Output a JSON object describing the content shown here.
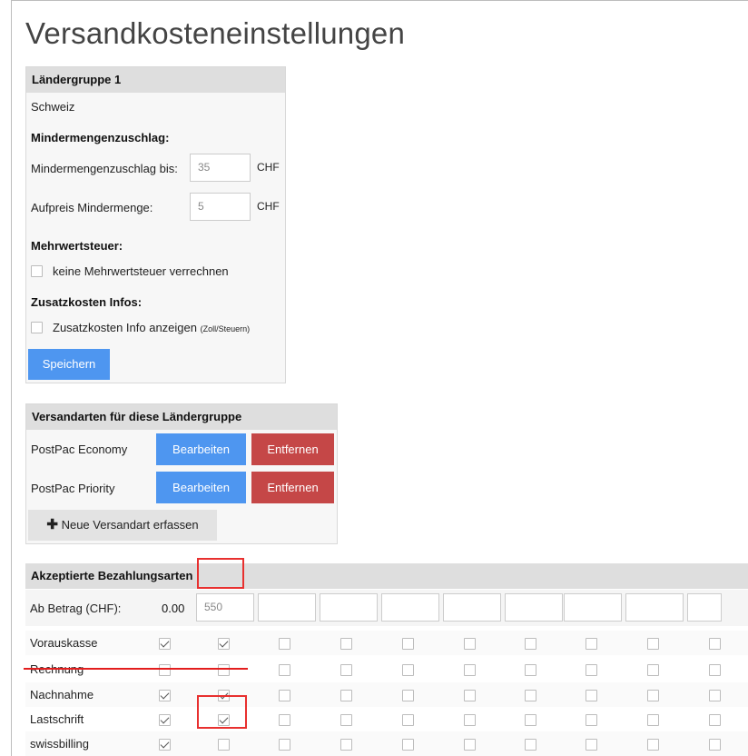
{
  "page": {
    "title": "Versandkosteneinstellungen"
  },
  "country_group": {
    "heading": "Ländergruppe 1",
    "country": "Schweiz",
    "surcharge_heading": "Mindermengenzuschlag:",
    "threshold_label": "Mindermengenzuschlag bis:",
    "threshold_value": "35",
    "threshold_currency": "CHF",
    "surcharge_label": "Aufpreis Mindermenge:",
    "surcharge_value": "5",
    "surcharge_currency": "CHF",
    "vat_heading": "Mehrwertsteuer:",
    "vat_checkbox_label": "keine Mehrwertsteuer verrechnen",
    "vat_checked": false,
    "extra_heading": "Zusatzkosten Infos:",
    "extra_checkbox_label": "Zusatzkosten Info anzeigen",
    "extra_checkbox_note": "(Zoll/Steuern)",
    "extra_checked": false,
    "save_label": "Speichern"
  },
  "shipping": {
    "heading": "Versandarten für diese Ländergruppe",
    "methods": [
      {
        "name": "PostPac Economy",
        "edit_label": "Bearbeiten",
        "remove_label": "Entfernen"
      },
      {
        "name": "PostPac Priority",
        "edit_label": "Bearbeiten",
        "remove_label": "Entfernen"
      }
    ],
    "add_label": "Neue Versandart erfassen"
  },
  "payments": {
    "heading": "Akzeptierte Bezahlungsarten",
    "amount_label": "Ab Betrag (CHF):",
    "amounts": [
      "0.00",
      "550",
      "",
      "",
      "",
      "",
      "",
      "",
      "",
      ""
    ],
    "rows": [
      {
        "name": "Vorauskasse",
        "checks": [
          true,
          true,
          false,
          false,
          false,
          false,
          false,
          false,
          false,
          false
        ],
        "struck": false
      },
      {
        "name": "Rechnung",
        "checks": [
          false,
          false,
          false,
          false,
          false,
          false,
          false,
          false,
          false,
          false
        ],
        "struck": true
      },
      {
        "name": "Nachnahme",
        "checks": [
          true,
          true,
          false,
          false,
          false,
          false,
          false,
          false,
          false,
          false
        ],
        "struck": false
      },
      {
        "name": "Lastschrift",
        "checks": [
          true,
          true,
          false,
          false,
          false,
          false,
          false,
          false,
          false,
          false
        ],
        "struck": false
      },
      {
        "name": "swissbilling",
        "checks": [
          true,
          false,
          false,
          false,
          false,
          false,
          false,
          false,
          false,
          false
        ],
        "struck": false
      }
    ]
  },
  "colors": {
    "primary": "#4e96f0",
    "danger": "#c54747",
    "annotation": "#e8302f"
  }
}
